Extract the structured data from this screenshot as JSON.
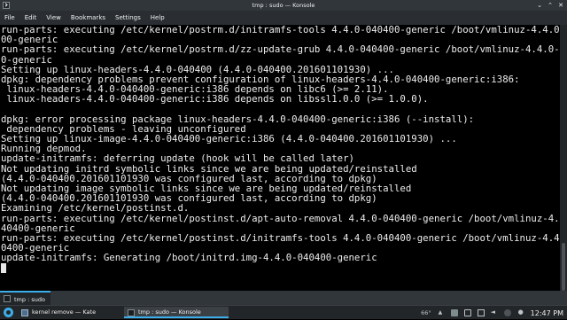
{
  "window": {
    "title": "tmp : sudo — Konsole",
    "controls": {
      "minimize": "⌄",
      "maximize": "⌃",
      "close": "✕"
    }
  },
  "menu": [
    "File",
    "Edit",
    "View",
    "Bookmarks",
    "Settings",
    "Help"
  ],
  "terminal": {
    "lines": [
      "run-parts: executing /etc/kernel/postrm.d/initramfs-tools 4.4.0-040400-generic /boot/vmlinuz-4.4.0-0404",
      "00-generic",
      "run-parts: executing /etc/kernel/postrm.d/zz-update-grub 4.4.0-040400-generic /boot/vmlinuz-4.4.0-04040",
      "0-generic",
      "Setting up linux-headers-4.4.0-040400 (4.4.0-040400.201601101930) ...",
      "dpkg: dependency problems prevent configuration of linux-headers-4.4.0-040400-generic:i386:",
      " linux-headers-4.4.0-040400-generic:i386 depends on libc6 (>= 2.11).",
      " linux-headers-4.4.0-040400-generic:i386 depends on libssl1.0.0 (>= 1.0.0).",
      "",
      "dpkg: error processing package linux-headers-4.4.0-040400-generic:i386 (--install):",
      " dependency problems - leaving unconfigured",
      "Setting up linux-image-4.4.0-040400-generic:i386 (4.4.0-040400.201601101930) ...",
      "Running depmod.",
      "update-initramfs: deferring update (hook will be called later)",
      "Not updating initrd symbolic links since we are being updated/reinstalled",
      "(4.4.0-040400.201601101930 was configured last, according to dpkg)",
      "Not updating image symbolic links since we are being updated/reinstalled",
      "(4.4.0-040400.201601101930 was configured last, according to dpkg)",
      "Examining /etc/kernel/postinst.d.",
      "run-parts: executing /etc/kernel/postinst.d/apt-auto-removal 4.4.0-040400-generic /boot/vmlinuz-4.4.0-0",
      "40400-generic",
      "run-parts: executing /etc/kernel/postinst.d/initramfs-tools 4.4.0-040400-generic /boot/vmlinuz-4.4.0-04",
      "0400-generic",
      "update-initramfs: Generating /boot/initrd.img-4.4.0-040400-generic"
    ]
  },
  "tabs": [
    {
      "label": "tmp : sudo"
    }
  ],
  "taskbar": {
    "tasks": [
      {
        "label": "kernel remove — Kate"
      },
      {
        "label": "tmp : sudo — Konsole"
      }
    ],
    "tray": {
      "temperature": "66°",
      "clock": "12:47 PM"
    }
  }
}
